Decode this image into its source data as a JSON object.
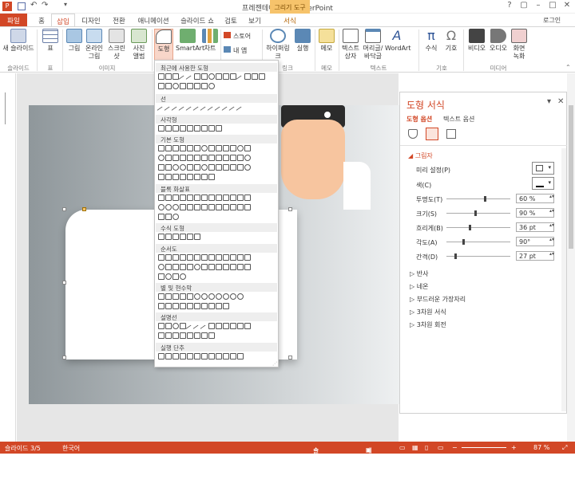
{
  "window": {
    "title": "프레젠테이션1 - PowerPoint",
    "context_tab_title": "그리기 도구",
    "help": "?",
    "restore": "▢",
    "minimize": "–",
    "maximize": "□",
    "close": "✕",
    "user": "로그인"
  },
  "tabs": [
    "파일",
    "홈",
    "삽입",
    "디자인",
    "전환",
    "애니메이션",
    "슬라이드 쇼",
    "검토",
    "보기",
    "서식"
  ],
  "ribbon": {
    "buttons": [
      {
        "label": "새 슬라이드",
        "icon": "new-slide-icon"
      },
      {
        "label": "표",
        "icon": "table-icon"
      },
      {
        "label": "그림",
        "icon": "picture-icon"
      },
      {
        "label": "온라인 그림",
        "icon": "online-picture-icon"
      },
      {
        "label": "스크린샷",
        "icon": "screenshot-icon"
      },
      {
        "label": "사진 앨범",
        "icon": "photo-album-icon"
      },
      {
        "label": "도형",
        "icon": "shapes-icon"
      },
      {
        "label": "SmartArt",
        "icon": "smartart-icon"
      },
      {
        "label": "차트",
        "icon": "chart-icon"
      },
      {
        "label": "스토어",
        "icon": "store-icon"
      },
      {
        "label": "내 앱",
        "icon": "my-apps-icon"
      },
      {
        "label": "하이퍼링크",
        "icon": "hyperlink-icon"
      },
      {
        "label": "실행",
        "icon": "action-icon"
      },
      {
        "label": "메모",
        "icon": "comment-icon"
      },
      {
        "label": "텍스트 상자",
        "icon": "textbox-icon"
      },
      {
        "label": "머리글/바닥글",
        "icon": "header-footer-icon"
      },
      {
        "label": "WordArt",
        "icon": "wordart-icon"
      },
      {
        "label": "수식",
        "icon": "equation-icon"
      },
      {
        "label": "기호",
        "icon": "symbol-icon"
      },
      {
        "label": "비디오",
        "icon": "video-icon"
      },
      {
        "label": "오디오",
        "icon": "audio-icon"
      },
      {
        "label": "화면 녹화",
        "icon": "screen-record-icon"
      }
    ],
    "groups": [
      "슬라이드",
      "표",
      "이미지",
      "링크",
      "메모",
      "텍스트",
      "기호",
      "미디어"
    ],
    "small_extra": "Ω"
  },
  "dropdown": {
    "sections": [
      "최근에 사용한 도형",
      "선",
      "사각형",
      "기본 도형",
      "블록 화살표",
      "수식 도형",
      "순서도",
      "별 및 현수막",
      "설명선",
      "실행 단추"
    ]
  },
  "pane": {
    "title": "도형 서식",
    "tab_shape": "도형 옵션",
    "tab_text": "텍스트 옵션",
    "section_shadow": "그림자",
    "preset_label": "미리 설정(P)",
    "color_label": "색(C)",
    "props": [
      {
        "label": "투명도(T)",
        "value": "60 %",
        "level": 0.6
      },
      {
        "label": "크기(S)",
        "value": "90 %",
        "level": 0.45
      },
      {
        "label": "흐리게(B)",
        "value": "36 pt",
        "level": 0.36
      },
      {
        "label": "각도(A)",
        "value": "90°",
        "level": 0.25
      },
      {
        "label": "간격(D)",
        "value": "27 pt",
        "level": 0.13
      }
    ],
    "sections": [
      "반사",
      "네온",
      "부드러운 가장자리",
      "3차원 서식",
      "3차원 회전"
    ]
  },
  "status": {
    "slide": "슬라이드 3/5",
    "language": "한국어",
    "notes": "슬라이드 노트",
    "comments": "메모",
    "zoom": "87 %"
  },
  "colors": {
    "accent": "#d24726",
    "context": "#f6c36b"
  }
}
